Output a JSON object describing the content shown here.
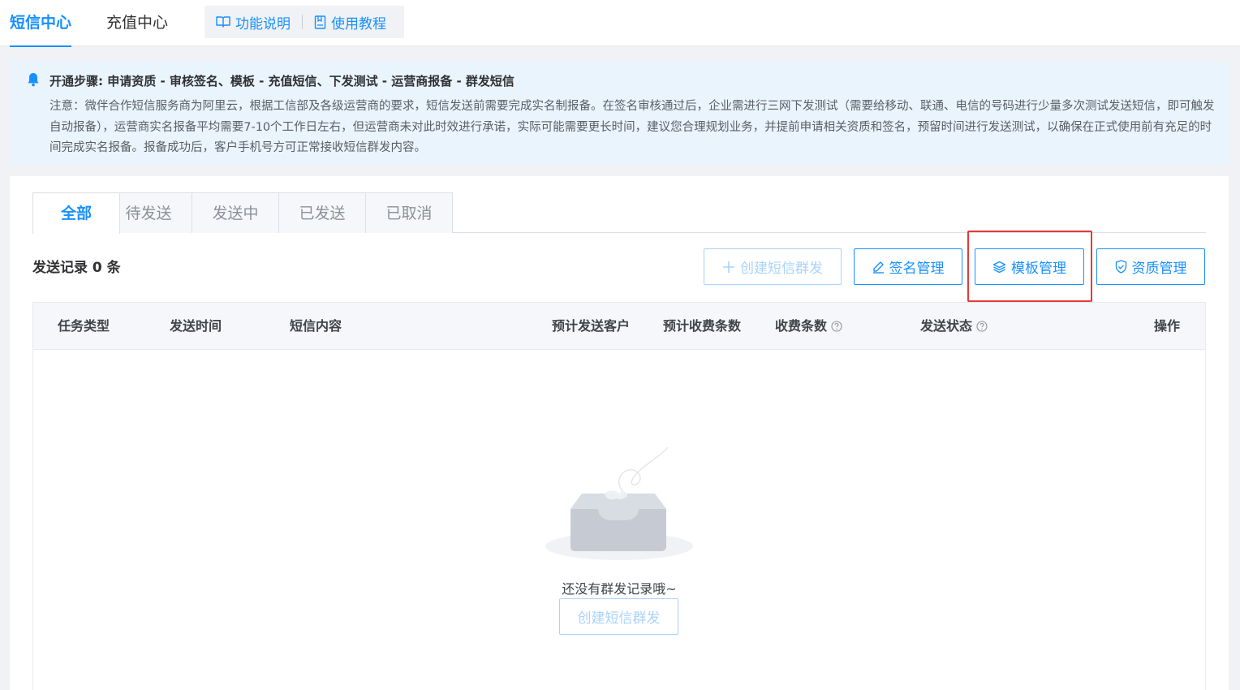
{
  "topnav": {
    "tabs": [
      {
        "label": "短信中心",
        "active": true
      },
      {
        "label": "充值中心",
        "active": false
      }
    ],
    "links": [
      {
        "label": "功能说明",
        "icon": "book-icon"
      },
      {
        "label": "使用教程",
        "icon": "doc-icon"
      }
    ]
  },
  "notice": {
    "title": "开通步骤: 申请资质 - 审核签名、模板 - 充值短信、下发测试 - 运营商报备 - 群发短信",
    "body": "注意：微伴合作短信服务商为阿里云，根据工信部及各级运营商的要求，短信发送前需要完成实名制报备。在签名审核通过后，企业需进行三网下发测试（需要给移动、联通、电信的号码进行少量多次测试发送短信，即可触发自动报备），运营商实名报备平均需要7-10个工作日左右，但运营商未对此时效进行承诺，实际可能需要更长时间，建议您合理规划业务，并提前申请相关资质和签名，预留时间进行发送测试，以确保在正式使用前有充足的时间完成实名报备。报备成功后，客户手机号方可正常接收短信群发内容。"
  },
  "tabs": [
    {
      "label": "全部",
      "active": true
    },
    {
      "label": "待发送",
      "active": false
    },
    {
      "label": "发送中",
      "active": false
    },
    {
      "label": "已发送",
      "active": false
    },
    {
      "label": "已取消",
      "active": false
    }
  ],
  "record_count": "发送记录 0 条",
  "buttons": {
    "create": "创建短信群发",
    "signature": "签名管理",
    "template": "模板管理",
    "qualification": "资质管理"
  },
  "table": {
    "headers": {
      "task_type": "任务类型",
      "send_time": "发送时间",
      "content": "短信内容",
      "est_customers": "预计发送客户",
      "est_charge": "预计收费条数",
      "charge": "收费条数",
      "status": "发送状态",
      "action": "操作"
    }
  },
  "empty": {
    "text": "还没有群发记录哦~",
    "button": "创建短信群发"
  },
  "colors": {
    "accent": "#1890ff",
    "highlight": "#e53935",
    "notice_bg": "#e9f4fd"
  }
}
